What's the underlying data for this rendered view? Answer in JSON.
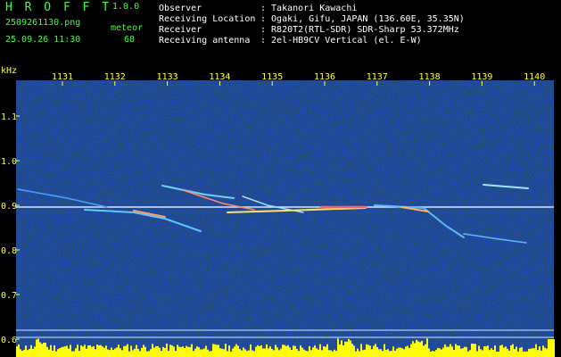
{
  "app": {
    "name": "H R O F F T",
    "version": "1.0.0"
  },
  "file": {
    "name": "2509261130.png",
    "datetime": "25.09.26 11:30"
  },
  "meteor": {
    "label": "meteor",
    "count": "68"
  },
  "info": [
    {
      "label": "Observer",
      "value": ": Takanori Kawachi"
    },
    {
      "label": "Receiving Location",
      "value": ": Ogaki, Gifu, JAPAN (136.60E, 35.35N)"
    },
    {
      "label": "Receiver",
      "value": ": R820T2(RTL-SDR) SDR-Sharp 53.372MHz"
    },
    {
      "label": "Receiving antenna",
      "value": ": 2el-HB9CV Vertical (el. E-W)"
    }
  ],
  "axis": {
    "y_unit": "kHz",
    "y_ticks": [
      "1.1",
      "1.0",
      "0.9",
      "0.8",
      "0.7",
      "0.6"
    ],
    "x_ticks": [
      "1131",
      "1132",
      "1133",
      "1134",
      "1135",
      "1136",
      "1137",
      "1138",
      "1139",
      "1140"
    ]
  },
  "colors": {
    "header_text": "#3dff3d",
    "tick_labels": "#ffff3a",
    "info_text": "#ffffff",
    "background": "#000080",
    "carrier_line": "#d8e8ff",
    "count_bars": "#ffff00"
  }
}
